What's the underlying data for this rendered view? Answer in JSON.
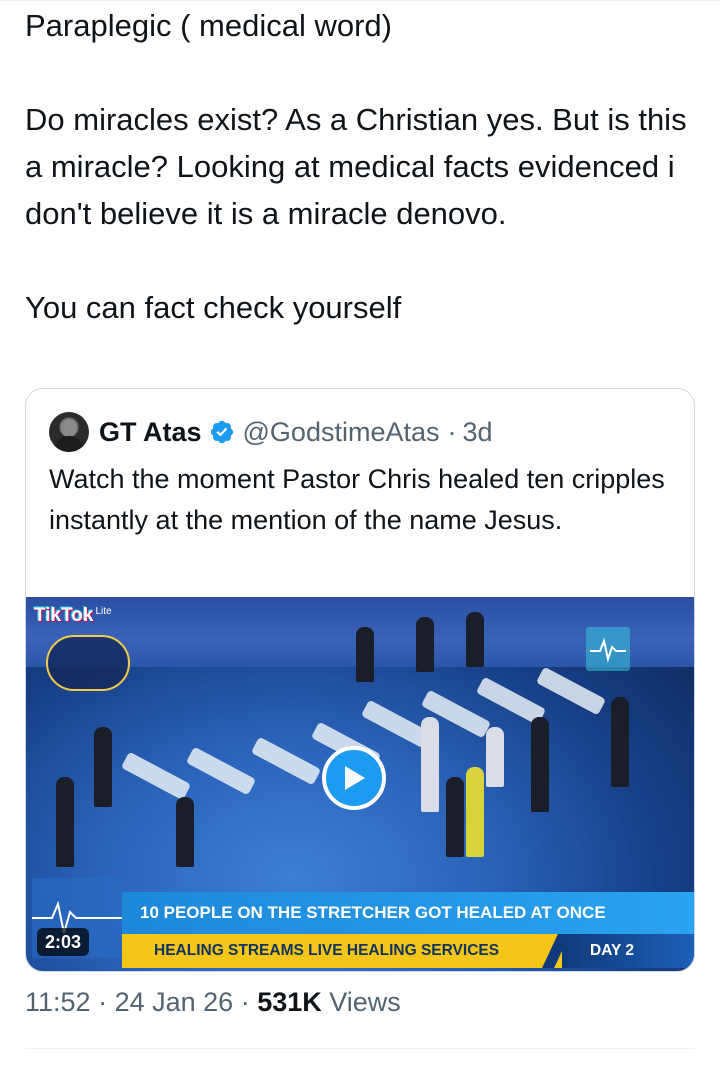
{
  "tweet": {
    "lines": [
      "Paraplegic ( medical word)",
      "",
      "Do miracles exist? As a Christian yes. But is this a miracle? Looking at medical facts evidenced i don't  believe it is a miracle denovo.",
      "",
      "You can fact check yourself"
    ],
    "time": "11:52",
    "date": "24 Jan 26",
    "views_count": "531K",
    "views_label": "Views"
  },
  "quoted": {
    "name": "GT Atas",
    "handle": "@GodstimeAtas",
    "age": "3d",
    "text": "Watch the moment Pastor Chris healed ten cripples instantly at the mention of the name Jesus.",
    "video": {
      "tiktok": "TikTok",
      "tiktok_sub": "Lite",
      "headline": "10 PEOPLE ON THE STRETCHER GOT HEALED AT ONCE",
      "subline": "HEALING STREAMS LIVE HEALING SERVICES",
      "day": "DAY 2",
      "duration": "2:03"
    }
  },
  "colors": {
    "verified": "#1d9bf0",
    "secondary_text": "#536471",
    "play_button": "#1d9bf0"
  }
}
